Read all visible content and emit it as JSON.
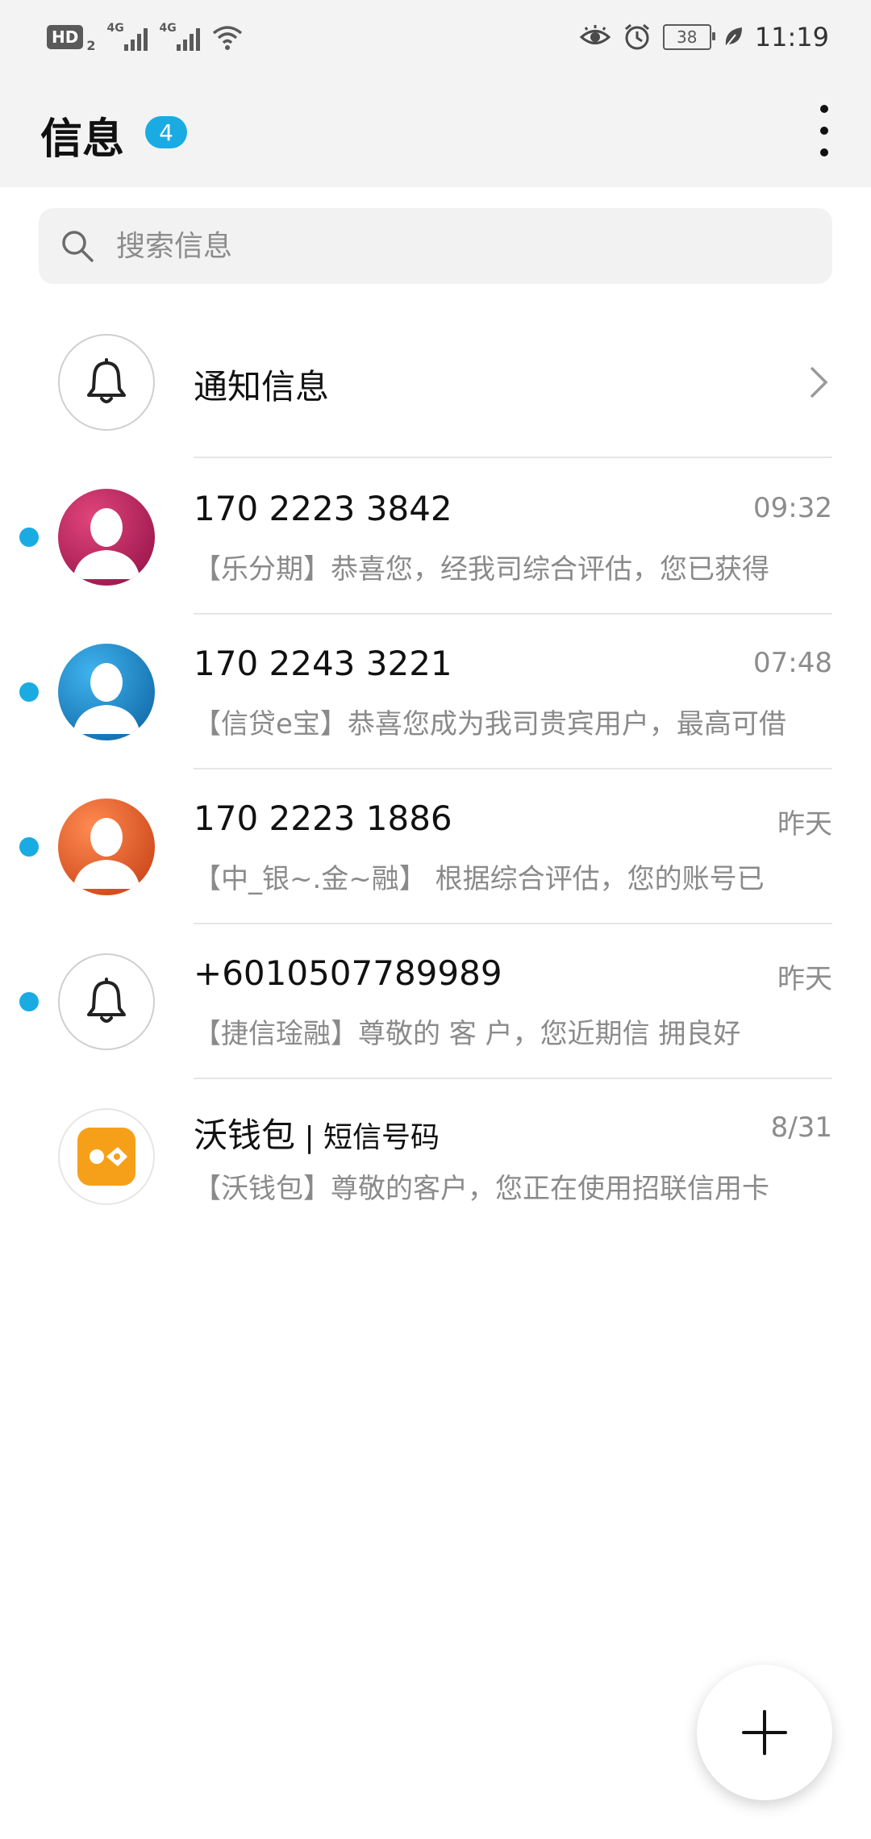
{
  "status_bar": {
    "hd_label": "HD",
    "hd_sub": "2",
    "sim1_tag": "4G",
    "sim2_tag": "4G",
    "battery_level": "38",
    "time": "11:19",
    "icons": [
      "eye-comfort-icon",
      "alarm-icon",
      "battery-icon",
      "leaf-icon",
      "wifi-icon",
      "signal-icon"
    ]
  },
  "header": {
    "title": "信息",
    "unread_badge": "4"
  },
  "search": {
    "placeholder": "搜索信息"
  },
  "notification_row": {
    "label": "通知信息"
  },
  "conversations": [
    {
      "name": "170 2223 3842",
      "time": "09:32",
      "preview": "【乐分期】恭喜您，经我司综合评估，您已获得",
      "unread": true,
      "avatar": "contact-avatar-magenta",
      "color": "#c2185b"
    },
    {
      "name": "170 2243 3221",
      "time": "07:48",
      "preview": "【信贷e宝】恭喜您成为我司贵宾用户，最高可借",
      "unread": true,
      "avatar": "contact-avatar-blue",
      "color": "#1e88c7"
    },
    {
      "name": "170 2223 1886",
      "time": "昨天",
      "preview": "【中_银~.金~融】 根据综合评估，您的账号已",
      "unread": true,
      "avatar": "contact-avatar-orange",
      "color": "#e8561e"
    },
    {
      "name": "+6010507789989",
      "time": "昨天",
      "preview": "【捷信琻融】尊敬的 客 户，您近期信 拥良好",
      "unread": true,
      "avatar": "bell-icon"
    },
    {
      "name": "沃钱包",
      "name_sub": " | 短信号码",
      "time": "8/31",
      "preview": "【沃钱包】尊敬的客户，您正在使用招联信用卡",
      "unread": false,
      "avatar": "wo-wallet-logo",
      "color": "#f39c12"
    }
  ],
  "colors": {
    "accent": "#1aabe3",
    "header_bg": "#f3f3f3"
  }
}
